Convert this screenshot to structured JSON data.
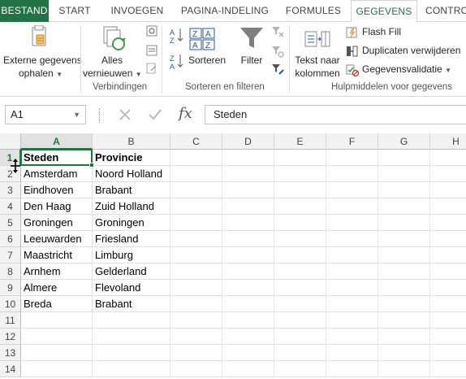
{
  "tabs": {
    "file": "BESTAND",
    "items": [
      "START",
      "INVOEGEN",
      "PAGINA-INDELING",
      "FORMULES",
      "GEGEVENS",
      "CONTRO"
    ],
    "active_index": 4
  },
  "ribbon": {
    "external": {
      "line1": "Externe gegevens",
      "line2": "ophalen"
    },
    "refresh": {
      "line1": "Alles",
      "line2": "vernieuwen"
    },
    "connections_group": "Verbindingen",
    "sort": "Sorteren",
    "filter": "Filter",
    "sort_filter_group": "Sorteren en filteren",
    "text_to_columns": {
      "line1": "Tekst naar",
      "line2": "kolommen"
    },
    "flash_fill": "Flash Fill",
    "remove_duplicates": "Duplicaten verwijderen",
    "data_validation": "Gegevensvalidatie",
    "tools_group": "Hulpmiddelen voor gegevens"
  },
  "formula_bar": {
    "name_box": "A1",
    "formula": "Steden",
    "fx": "fx"
  },
  "grid": {
    "columns": [
      "A",
      "B",
      "C",
      "D",
      "E",
      "F",
      "G",
      "H"
    ],
    "active_col": "A",
    "active_row": 1,
    "row_numbers": [
      "1",
      "2",
      "3",
      "4",
      "5",
      "6",
      "7",
      "8",
      "9",
      "10",
      "11",
      "12",
      "13",
      "14"
    ],
    "rows": [
      [
        "Steden",
        "Provincie"
      ],
      [
        "Amsterdam",
        "Noord Holland"
      ],
      [
        "Eindhoven",
        "Brabant"
      ],
      [
        "Den Haag",
        "Zuid Holland"
      ],
      [
        "Groningen",
        "Groningen"
      ],
      [
        "Leeuwarden",
        "Friesland"
      ],
      [
        "Maastricht",
        "Limburg"
      ],
      [
        "Arnhem",
        "Gelderland"
      ],
      [
        "Almere",
        "Flevoland"
      ],
      [
        "Breda",
        "Brabant"
      ]
    ]
  },
  "colors": {
    "accent": "#217346"
  }
}
